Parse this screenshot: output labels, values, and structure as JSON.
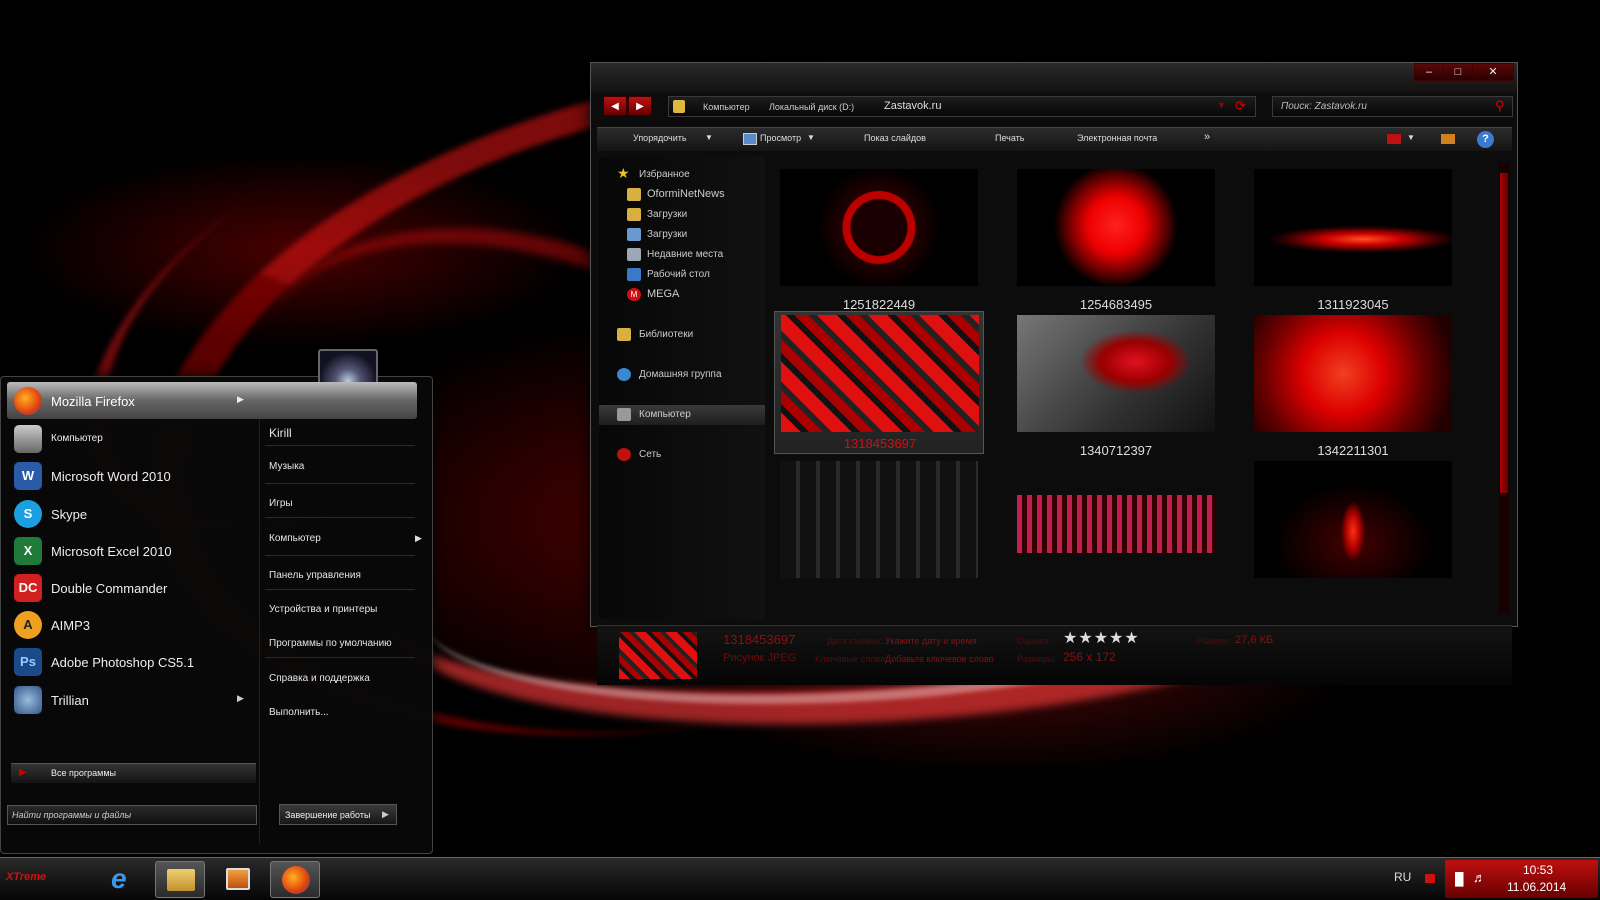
{
  "colors": {
    "accent": "#e00000",
    "dark": "#0a0a0a"
  },
  "explorer": {
    "breadcrumb": [
      "Компьютер",
      "Локальный диск (D:)",
      "Zastavok.ru"
    ],
    "search_placeholder": "Поиск: Zastavok.ru",
    "toolbar": {
      "organize": "Упорядочить",
      "view": "Просмотр",
      "slideshow": "Показ слайдов",
      "print": "Печать",
      "email": "Электронная почта",
      "more": "»"
    },
    "nav": {
      "favorites": "Избранное",
      "favorites_items": [
        "OformiNetNews",
        "Загрузки",
        "Загрузки",
        "Недавние места",
        "Рабочий стол",
        "MEGA"
      ],
      "libraries": "Библиотеки",
      "homegroup": "Домашняя группа",
      "computer": "Компьютер",
      "network": "Сеть"
    },
    "thumbnails": [
      {
        "name": "1251822449",
        "icon": "fire-emblem-icon"
      },
      {
        "name": "1254683495",
        "icon": "red-flower-icon"
      },
      {
        "name": "1311923045",
        "icon": "red-streak-icon"
      },
      {
        "name": "1318453697",
        "icon": "red-cubes-icon",
        "selected": true
      },
      {
        "name": "1340712397",
        "icon": "motorcycle-icon"
      },
      {
        "name": "1342211301",
        "icon": "red-lily-icon"
      },
      {
        "name": "",
        "icon": "dark-cubes-icon"
      },
      {
        "name": "",
        "icon": "grid-lights-icon"
      },
      {
        "name": "",
        "icon": "flame-icon"
      }
    ],
    "details": {
      "name": "1318453697",
      "type": "Рисунок JPEG",
      "date_label": "Дата съемки:",
      "date_value": "Укажите дату и время",
      "tags_label": "Ключевые слова:",
      "tags_value": "Добавьте ключевое слово",
      "rating_label": "Оценка:",
      "rating": 5,
      "dims_label": "Размеры:",
      "dims_value": "256 x 172",
      "size_label": "Размер:",
      "size_value": "27,6 КБ"
    }
  },
  "start_menu": {
    "programs": [
      {
        "label": "Mozilla Firefox",
        "icon": "firefox-icon",
        "submenu": true
      },
      {
        "label": "Компьютер",
        "icon": "computer-icon",
        "submenu": false
      },
      {
        "label": "Microsoft Word 2010",
        "icon": "word-icon",
        "submenu": false
      },
      {
        "label": "Skype",
        "icon": "skype-icon",
        "submenu": false
      },
      {
        "label": "Microsoft Excel 2010",
        "icon": "excel-icon",
        "submenu": false
      },
      {
        "label": "Double Commander",
        "icon": "double-commander-icon",
        "submenu": false
      },
      {
        "label": "AIMP3",
        "icon": "aimp-icon",
        "submenu": false
      },
      {
        "label": "Adobe Photoshop CS5.1",
        "icon": "photoshop-icon",
        "submenu": false
      },
      {
        "label": "Trillian",
        "icon": "trillian-icon",
        "submenu": true
      }
    ],
    "all_programs": "Все программы",
    "search_placeholder": "Найти программы и файлы",
    "right_items": [
      {
        "label": "Kirill",
        "submenu": false
      },
      {
        "label": "Музыка",
        "submenu": false
      },
      {
        "label": "Игры",
        "submenu": false
      },
      {
        "label": "Компьютер",
        "submenu": true
      },
      {
        "label": "Панель управления",
        "submenu": false
      },
      {
        "label": "Устройства и принтеры",
        "submenu": false
      },
      {
        "label": "Программы по умолчанию",
        "submenu": false
      },
      {
        "label": "Справка и поддержка",
        "submenu": false
      },
      {
        "label": "Выполнить...",
        "submenu": false
      }
    ],
    "shutdown": "Завершение работы"
  },
  "taskbar": {
    "start_label": "XTreme",
    "pinned": [
      {
        "icon": "internet-explorer-icon"
      },
      {
        "icon": "file-explorer-icon"
      },
      {
        "icon": "media-player-icon"
      },
      {
        "icon": "firefox-icon"
      }
    ],
    "lang": "RU",
    "time": "10:53",
    "date": "11.06.2014"
  }
}
